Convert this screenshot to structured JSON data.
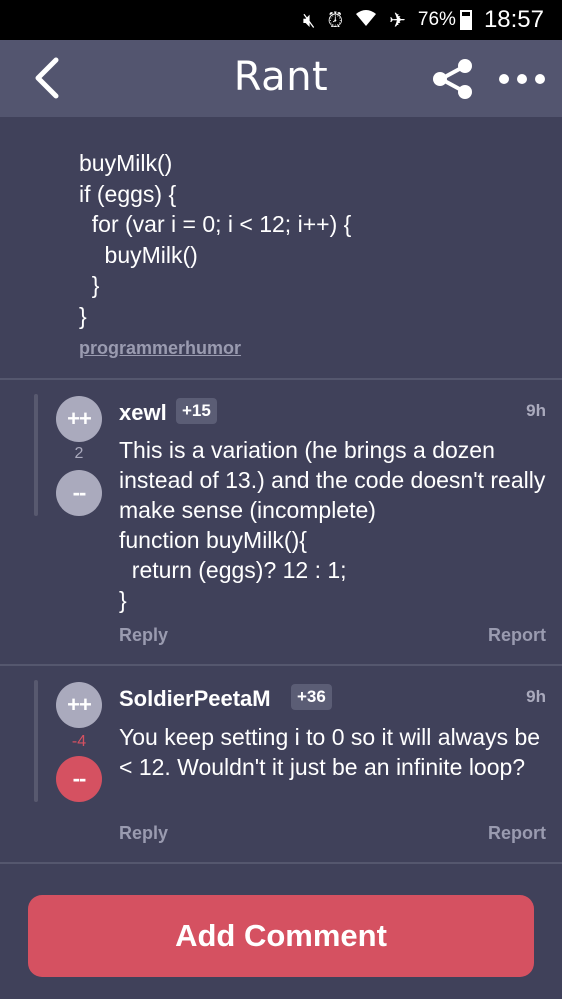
{
  "status_bar": {
    "icons": [
      "mute-icon",
      "alarm-icon",
      "wifi-icon",
      "airplane-icon"
    ],
    "battery": "76%",
    "time": "18:57"
  },
  "header": {
    "title": "Rant",
    "back_icon": "back-arrow-icon",
    "share_icon": "share-icon",
    "more_icon": "more-dots-icon"
  },
  "rant": {
    "body": "buyMilk()\nif (eggs) {\n  for (var i = 0; i < 12; i++) {\n    buyMilk()\n  }\n}",
    "tag": "programmerhumor"
  },
  "comments": [
    {
      "upvote_label": "++",
      "downvote_label": "--",
      "score": "2",
      "vote_state": "none",
      "username": "xewl",
      "user_score": "+15",
      "time": "9h",
      "text": "This is a variation (he brings a dozen instead of 13.) and the code doesn't really make sense (incomplete)\nfunction buyMilk(){\n  return (eggs)? 12 : 1;\n}",
      "reply_label": "Reply",
      "report_label": "Report"
    },
    {
      "upvote_label": "++",
      "downvote_label": "--",
      "score": "-4",
      "vote_state": "downvoted",
      "username": "SoldierPeetaM",
      "user_score": "+36",
      "time": "9h",
      "text": "You keep setting i to 0 so it will always be < 12. Wouldn't it just be an infinite loop?",
      "reply_label": "Reply",
      "report_label": "Report"
    }
  ],
  "footer": {
    "add_comment_label": "Add Comment"
  },
  "colors": {
    "background": "#40415a",
    "header": "#53556f",
    "accent": "#d55161",
    "vote_neutral": "#aaaabd",
    "muted_text": "#9a9bb0"
  }
}
